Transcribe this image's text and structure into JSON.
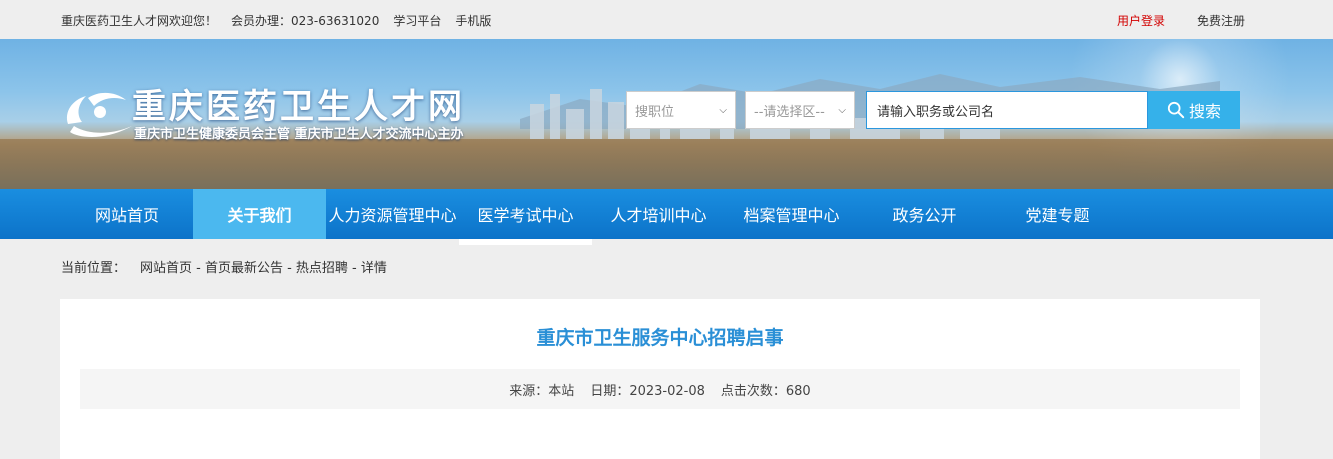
{
  "topbar": {
    "welcome": "重庆医药卫生人才网欢迎您！",
    "hotline": "会员办理：023-63631020",
    "study": "学习平台",
    "mobile": "手机版",
    "login": "用户登录",
    "register": "免费注册"
  },
  "header": {
    "title": "重庆医药卫生人才网",
    "subtitle": "重庆市卫生健康委员会主管 重庆市卫生人才交流中心主办"
  },
  "search": {
    "job_select": "搜职位",
    "area_select": "--请选择区--",
    "placeholder": "请输入职务或公司名",
    "button": "搜索"
  },
  "nav": {
    "items": [
      {
        "label": "网站首页"
      },
      {
        "label": "关于我们"
      },
      {
        "label": "人力资源管理中心"
      },
      {
        "label": "医学考试中心"
      },
      {
        "label": "人才培训中心"
      },
      {
        "label": "档案管理中心"
      },
      {
        "label": "政务公开"
      },
      {
        "label": "党建专题"
      }
    ]
  },
  "breadcrumb": {
    "label": "当前位置：",
    "path": "网站首页 - 首页最新公告 - 热点招聘 - 详情"
  },
  "article": {
    "title": "重庆市卫生服务中心招聘启事",
    "source": "来源：本站",
    "date": "日期：2023-02-08",
    "clicks": "点击次数：680"
  },
  "colors": {
    "nav": "#0c73c9",
    "nav_active": "#4bb8ef",
    "title": "#2a8fd6",
    "login": "#d20000",
    "search_button": "#35b1ea"
  }
}
